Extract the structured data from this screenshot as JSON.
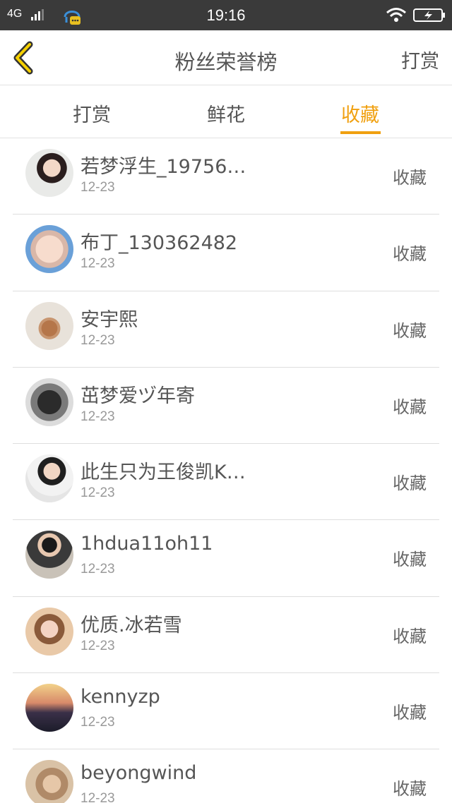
{
  "status_bar": {
    "network": "4G",
    "time": "19:16"
  },
  "nav": {
    "title": "粉丝荣誉榜",
    "right_label": "打赏",
    "accent_color": "#f0a010"
  },
  "tabs": [
    {
      "label": "打赏",
      "active": false
    },
    {
      "label": "鲜花",
      "active": false
    },
    {
      "label": "收藏",
      "active": true
    }
  ],
  "list": [
    {
      "name": "若梦浮生_19756…",
      "date": "12-23",
      "action": "收藏",
      "avatar": "avatar-woman-portrait"
    },
    {
      "name": "布丁_130362482",
      "date": "12-23",
      "action": "收藏",
      "avatar": "avatar-baby-face"
    },
    {
      "name": "安宇熙",
      "date": "12-23",
      "action": "收藏",
      "avatar": "avatar-puppy"
    },
    {
      "name": "茁梦爱ヅ年寄",
      "date": "12-23",
      "action": "收藏",
      "avatar": "avatar-bw-photo"
    },
    {
      "name": "此生只为王俊凯K…",
      "date": "12-23",
      "action": "收藏",
      "avatar": "avatar-boy-portrait"
    },
    {
      "name": "1hdua11oh11",
      "date": "12-23",
      "action": "收藏",
      "avatar": "avatar-man-hat"
    },
    {
      "name": "优质.冰若雪",
      "date": "12-23",
      "action": "收藏",
      "avatar": "avatar-girl-portrait"
    },
    {
      "name": "kennyzp",
      "date": "12-23",
      "action": "收藏",
      "avatar": "avatar-sunset-car"
    },
    {
      "name": "beyongwind",
      "date": "12-23",
      "action": "收藏",
      "avatar": "avatar-woman-sepia"
    }
  ]
}
